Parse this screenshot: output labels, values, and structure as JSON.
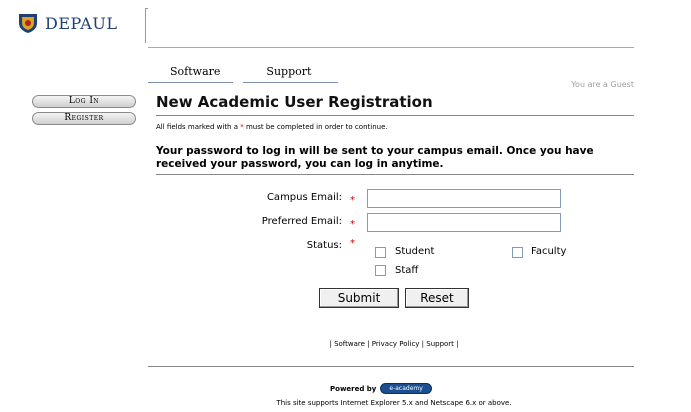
{
  "logo": {
    "text": "DEPAUL"
  },
  "tabs": [
    {
      "label": "Software"
    },
    {
      "label": "Support"
    }
  ],
  "guest_text": "You are a Guest",
  "side": {
    "login": "Log In",
    "register": "Register"
  },
  "form": {
    "title": "New Academic User Registration",
    "note_before": "All fields marked with a ",
    "note_ast": "*",
    "note_after": " must be completed in order to continue.",
    "info": "Your password to log in will be sent to your campus email. Once you have received your password, you can log in anytime.",
    "campus_email_label": "Campus Email:",
    "preferred_email_label": "Preferred Email:",
    "status_label": "Status:",
    "required_mark": "*",
    "status_options": {
      "student": "Student",
      "faculty": "Faculty",
      "staff": "Staff"
    },
    "submit_label": "Submit",
    "reset_label": "Reset"
  },
  "footer": {
    "links": "| Software | Privacy Policy | Support |",
    "powered_by": "Powered by",
    "eacademy": "e-academy",
    "supports": "This site supports Internet Explorer 5.x and Netscape 6.x or above."
  },
  "colors": {
    "brand_blue": "#1f3f78",
    "required_red": "#cc0000"
  }
}
